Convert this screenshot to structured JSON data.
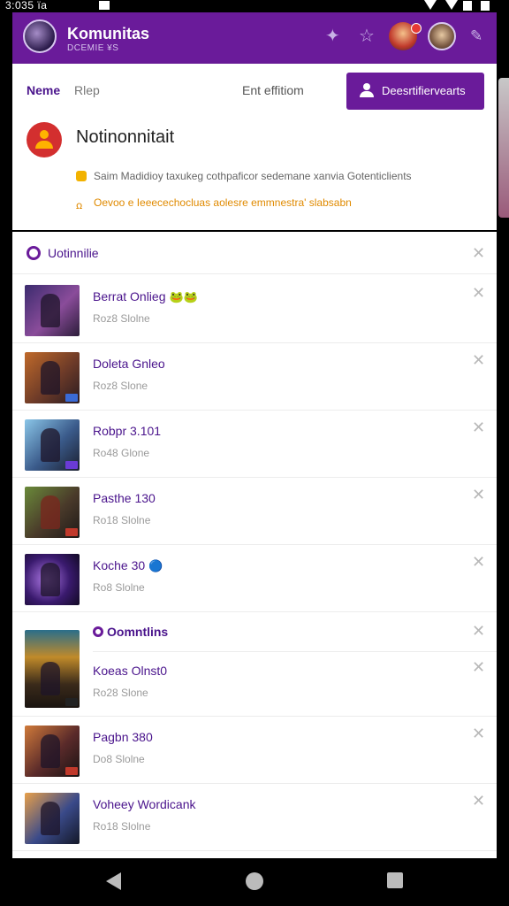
{
  "status_bar": {
    "time": "3:035 ïa"
  },
  "app_bar": {
    "title": "Komunitas",
    "subtitle": "DCEMIE ¥S"
  },
  "card": {
    "tabs": [
      "Neme",
      "Rlep",
      "Ent effitiom"
    ],
    "button_label": "Deesrtifiervearts",
    "notification_title": "Notinonnitait",
    "line1": "Saim Madidioy taxukeg cothpaficor sedemane xanvia Gotenticlients",
    "line2": "Oevoo e Ieeecechocluas aolesre emmnestra' slabsabn"
  },
  "list": {
    "section_title": "Uotinnilie",
    "items": [
      {
        "name": "Berrat Onlieg",
        "emoji": "🐸🐸",
        "sub": "Roz8 Slolne"
      },
      {
        "name": "Doleta Gnleo",
        "emoji": "",
        "sub": "Roz8 Slone"
      },
      {
        "name": "Robpr 3.101",
        "emoji": "",
        "sub": "Ro48 Glone"
      },
      {
        "name": "Pasthe 130",
        "emoji": "",
        "sub": "Ro18 Slolne"
      },
      {
        "name": "Koche 30",
        "emoji": "🔵",
        "sub": "Ro8 Slolne"
      },
      {
        "name": "Koeas Olnst0",
        "emoji": "",
        "sub": "Ro28 Slone"
      },
      {
        "name": "Pagbn 380",
        "emoji": "",
        "sub": "Do8 Slolne"
      },
      {
        "name": "Voheey Wordicank",
        "emoji": "",
        "sub": "Ro18 Slolne"
      }
    ],
    "subsection_title": "Oomntlins"
  },
  "colors": {
    "primary": "#6a1b9a",
    "accent_orange": "#e08a00",
    "notification_red": "#d32f2f"
  }
}
